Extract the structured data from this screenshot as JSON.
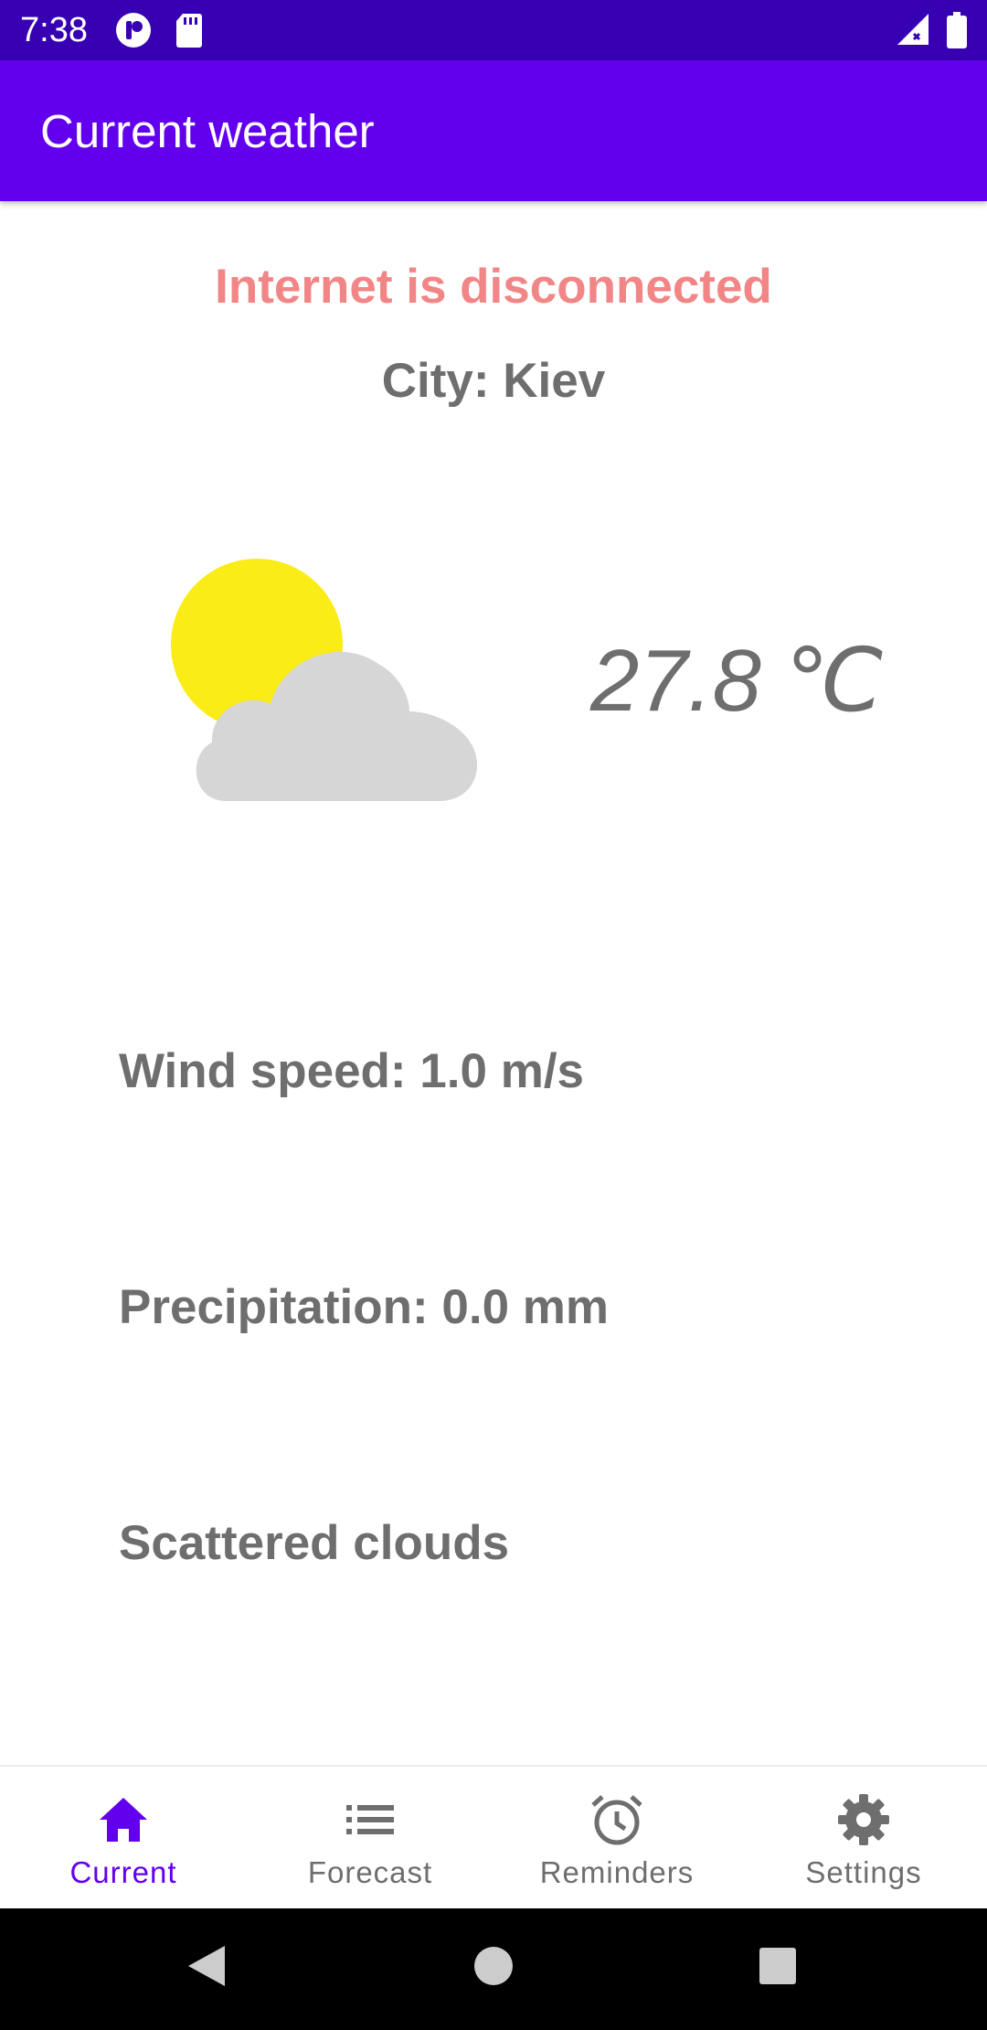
{
  "status_bar": {
    "time": "7:38",
    "icons": [
      "notification-app-icon",
      "sd-card-icon",
      "signal-icon",
      "battery-icon"
    ]
  },
  "app_bar": {
    "title": "Current weather",
    "color": "#6200EE"
  },
  "main": {
    "connection_status": "Internet is disconnected",
    "city": "City: Kiev",
    "weather_icon": "partly-cloudy-icon",
    "temperature": "27.8 ℃",
    "wind_speed": "Wind speed: 1.0 m/s",
    "precipitation": "Precipitation: 0.0 mm",
    "description": "Scattered clouds"
  },
  "bottom_nav": {
    "items": [
      {
        "label": "Current",
        "icon": "home-icon",
        "active": true
      },
      {
        "label": "Forecast",
        "icon": "list-icon",
        "active": false
      },
      {
        "label": "Reminders",
        "icon": "alarm-clock-icon",
        "active": false
      },
      {
        "label": "Settings",
        "icon": "gear-icon",
        "active": false
      }
    ],
    "active_color": "#6200EE",
    "inactive_color": "#6e6e6e"
  },
  "system_nav": {
    "buttons": [
      "back-icon",
      "home-circle-icon",
      "recents-icon"
    ]
  },
  "colors": {
    "status_bar": "#3700B3",
    "alert_text": "#F28585",
    "body_text": "#6e6e6e"
  }
}
